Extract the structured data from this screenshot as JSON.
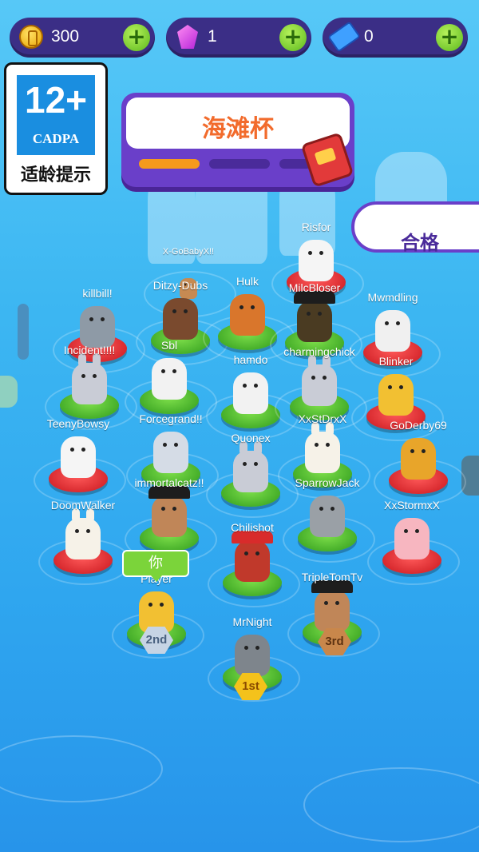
{
  "currencies": [
    {
      "type": "coin-icon",
      "value": "300"
    },
    {
      "type": "gem-icon",
      "value": "1"
    },
    {
      "type": "ticket-icon",
      "value": "0"
    }
  ],
  "age_rating": {
    "number": "12+",
    "org": "CADPA",
    "caption": "适龄提示"
  },
  "cup": {
    "title": "海滩杯",
    "progress_segments": [
      "#f59a1d",
      "#4a2b9a",
      "#4a2b9a"
    ]
  },
  "status": {
    "label": "合格"
  },
  "you_label": "你",
  "players": [
    {
      "name": "Risfor",
      "ring": "red",
      "color": "#f5f5f5",
      "animal": "panda"
    },
    {
      "name": "X-GoBabyX!!",
      "ring": "none",
      "color": "#c68a52",
      "animal": "monkey"
    },
    {
      "name": "killbill!",
      "ring": "red",
      "color": "#8e9aa6",
      "animal": "cat"
    },
    {
      "name": "Ditzy-Dubs",
      "ring": "green",
      "color": "#7a4a2e",
      "animal": "bear"
    },
    {
      "name": "Hulk",
      "ring": "green",
      "color": "#d9762c",
      "animal": "tiger"
    },
    {
      "name": "MilcBloser",
      "ring": "green",
      "color": "#4a3b22",
      "animal": "pirate"
    },
    {
      "name": "Mwmdling",
      "ring": "red",
      "color": "#f0f0f0",
      "animal": "zebra"
    },
    {
      "name": "Incident!!!!",
      "ring": "green",
      "color": "#c9ccd6",
      "animal": "bunny"
    },
    {
      "name": "Sbl",
      "ring": "green",
      "color": "#f2f2f2",
      "animal": "dalmatian"
    },
    {
      "name": "hamdo",
      "ring": "green",
      "color": "#f2f2f2",
      "animal": "dalmatian"
    },
    {
      "name": "charmingchick",
      "ring": "green",
      "color": "#c9ccd6",
      "animal": "bunny"
    },
    {
      "name": "Blinker",
      "ring": "red",
      "color": "#f2c032",
      "animal": "cat"
    },
    {
      "name": "TeenyBowsy",
      "ring": "red",
      "color": "#f5f5f5",
      "animal": "panda"
    },
    {
      "name": "Forcegrand!!",
      "ring": "green",
      "color": "#d5dce6",
      "animal": "seal"
    },
    {
      "name": "Quonex",
      "ring": "green",
      "color": "#c9ccd6",
      "animal": "bunny"
    },
    {
      "name": "XxStDrxX",
      "ring": "green",
      "color": "#f6f2e8",
      "animal": "unicorn"
    },
    {
      "name": "GoDerby69",
      "ring": "red",
      "color": "#e8a52a",
      "animal": "giraffe"
    },
    {
      "name": "immortalcatz!!",
      "ring": "green",
      "color": "#c08658",
      "animal": "pirate"
    },
    {
      "name": "SparrowJack",
      "ring": "green",
      "color": "#9aa0a6",
      "animal": "tiger"
    },
    {
      "name": "DoomWalker",
      "ring": "red",
      "color": "#f6f2e8",
      "animal": "unicorn"
    },
    {
      "name": "XxStormxX",
      "ring": "red",
      "color": "#f7b6c0",
      "animal": "pig"
    },
    {
      "name": "Chilishot",
      "ring": "green",
      "color": "#c0392b",
      "animal": "santa"
    },
    {
      "name": "Player",
      "ring": "green",
      "color": "#f2c032",
      "animal": "duck"
    },
    {
      "name": "TripleTomTv",
      "ring": "green",
      "color": "#c08658",
      "animal": "pirate"
    },
    {
      "name": "MrNight",
      "ring": "green",
      "color": "#7e858c",
      "animal": "cat"
    }
  ],
  "ranks": [
    {
      "label": "1st",
      "color": "#f4c21b",
      "text": "#8a4b00"
    },
    {
      "label": "2nd",
      "color": "#c6d4e4",
      "text": "#4a6280"
    },
    {
      "label": "3rd",
      "color": "#c9874b",
      "text": "#5e3312"
    }
  ]
}
